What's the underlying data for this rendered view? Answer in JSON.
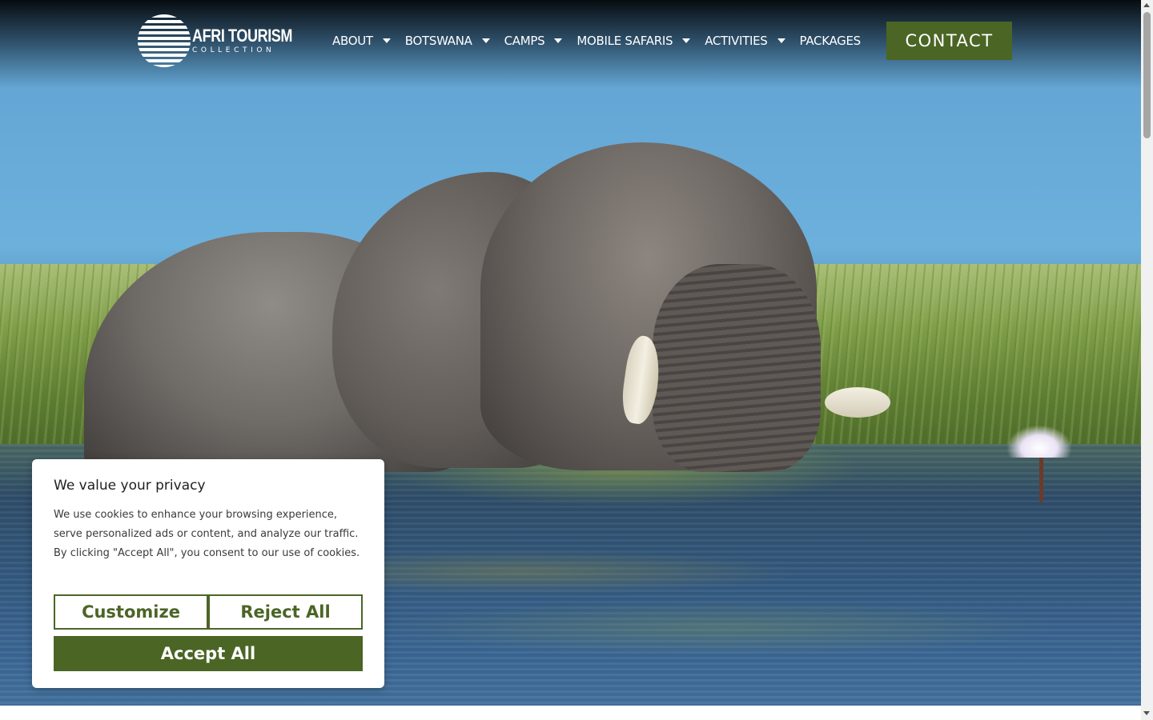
{
  "brand": {
    "logo_title": "AFRI TOURISM",
    "logo_subtitle": "COLLECTION"
  },
  "nav": {
    "items": [
      {
        "label": "ABOUT",
        "has_dropdown": true
      },
      {
        "label": "BOTSWANA",
        "has_dropdown": true
      },
      {
        "label": "CAMPS",
        "has_dropdown": true
      },
      {
        "label": "MOBILE SAFARIS",
        "has_dropdown": true
      },
      {
        "label": "ACTIVITIES",
        "has_dropdown": true
      },
      {
        "label": "PACKAGES",
        "has_dropdown": false
      }
    ],
    "contact_label": "CONTACT"
  },
  "hero": {
    "image_subject": "elephant-in-river"
  },
  "cookie_banner": {
    "title": "We value your privacy",
    "text": "We use cookies to enhance your browsing experience, serve personalized ads or content, and analyze our traffic. By clicking \"Accept All\", you consent to our use of cookies.",
    "customize_label": "Customize",
    "reject_label": "Reject All",
    "accept_label": "Accept All"
  },
  "colors": {
    "accent_green": "#4b6525",
    "white": "#ffffff",
    "text_dark": "#212121"
  }
}
